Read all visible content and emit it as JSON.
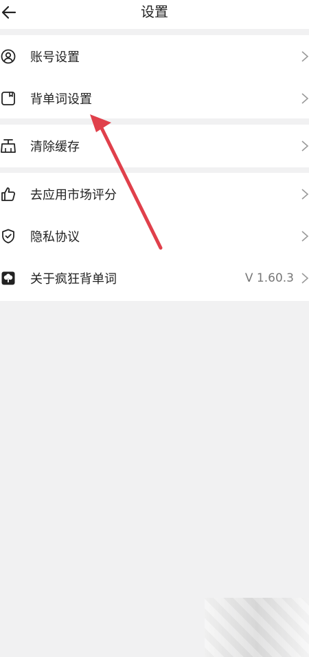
{
  "header": {
    "title": "设置",
    "back_icon": "back-arrow-icon"
  },
  "groups": [
    {
      "items": [
        {
          "label": "账号设置",
          "icon": "user-circle-icon"
        },
        {
          "label": "背单词设置",
          "icon": "bookmark-square-icon"
        }
      ]
    },
    {
      "items": [
        {
          "label": "清除缓存",
          "icon": "broom-icon"
        }
      ]
    },
    {
      "items": [
        {
          "label": "去应用市场评分",
          "icon": "thumbs-up-icon"
        },
        {
          "label": "隐私协议",
          "icon": "shield-check-icon"
        },
        {
          "label": "关于疯狂背单词",
          "icon": "app-logo-icon",
          "value": "V 1.60.3"
        }
      ]
    }
  ],
  "colors": {
    "background": "#f1f1f2",
    "card": "#ffffff",
    "annotation_arrow": "#e0404b"
  }
}
